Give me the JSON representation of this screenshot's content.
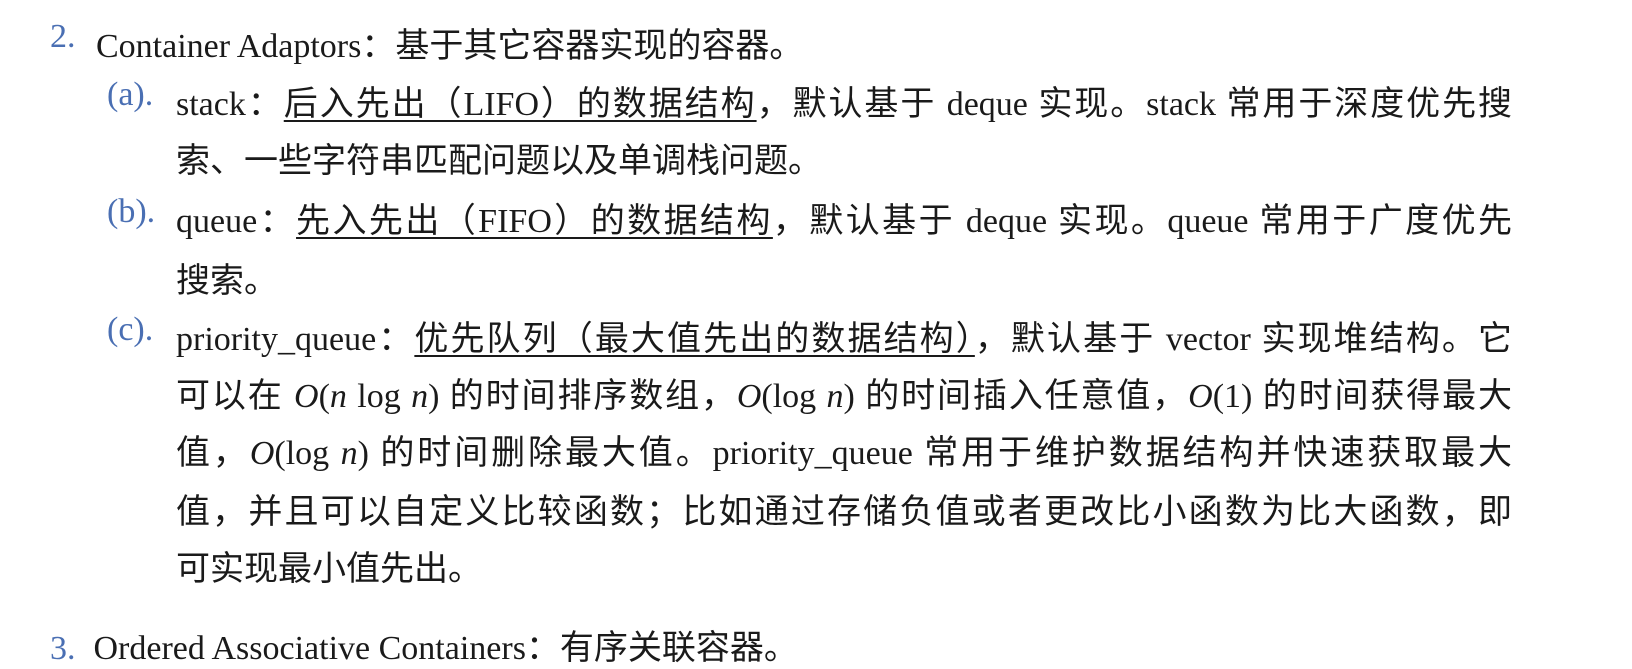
{
  "top_fragment": "                          ",
  "item2": {
    "number": "2.",
    "title": "Container Adaptors",
    "sep": "：",
    "desc": "基于其它容器实现的容器。"
  },
  "sub_a": {
    "marker": "(a).",
    "name": "stack",
    "sep": "：",
    "underlined": "后入先出（LIFO）的数据结构",
    "rest1": "，默认基于 deque 实现。stack 常用于深度优先搜",
    "line2": "索、一些字符串匹配问题以及单调栈问题。"
  },
  "sub_b": {
    "marker": "(b).",
    "name": "queue",
    "sep": "：",
    "underlined": "先入先出（FIFO）的数据结构",
    "rest1": "，默认基于 deque 实现。queue 常用于广度优先",
    "line2": "搜索。"
  },
  "sub_c": {
    "marker": "(c).",
    "name": "priority_queue",
    "sep": "：",
    "underlined": "优先队列（最大值先出的数据结构）",
    "rest1": "，默认基于 vector 实现堆结构。它",
    "line2_a": "可以在 ",
    "line2_m1": "O",
    "line2_b": "(",
    "line2_m2": "n",
    "line2_c": " log ",
    "line2_m3": "n",
    "line2_d": ") 的时间排序数组，",
    "line2_m4": "O",
    "line2_e": "(log ",
    "line2_m5": "n",
    "line2_f": ") 的时间插入任意值，",
    "line2_m6": "O",
    "line2_g": "(1) 的时间获得最大",
    "line3_a": "值，",
    "line3_m1": "O",
    "line3_b": "(log ",
    "line3_m2": "n",
    "line3_c": ") 的时间删除最大值。priority_queue 常用于维护数据结构并快速获取最大",
    "line4": "值，并且可以自定义比较函数；比如通过存储负值或者更改比小函数为比大函数，即",
    "line5": "可实现最小值先出。"
  },
  "bottom_fragment": {
    "number": "3.",
    "text": "Ordered Associative Containers：有序关联容器。"
  },
  "colors": {
    "marker": "#4a6fb3",
    "text": "#1a1a1a"
  }
}
